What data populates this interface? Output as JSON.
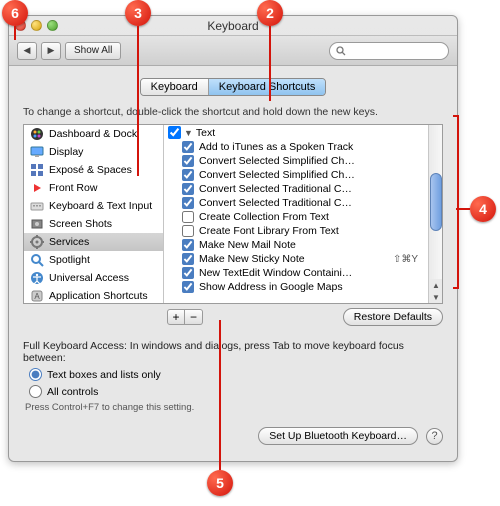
{
  "window": {
    "title": "Keyboard"
  },
  "toolbar": {
    "back_label": "◀",
    "fwd_label": "▶",
    "show_all": "Show All",
    "search_placeholder": ""
  },
  "tabs": [
    {
      "label": "Keyboard",
      "active": false
    },
    {
      "label": "Keyboard Shortcuts",
      "active": true
    }
  ],
  "hint": "To change a shortcut, double-click the shortcut and hold down the new keys.",
  "categories": [
    {
      "label": "Dashboard & Dock",
      "icon": "dashboard",
      "selected": false
    },
    {
      "label": "Display",
      "icon": "display",
      "selected": false
    },
    {
      "label": "Exposé & Spaces",
      "icon": "expose",
      "selected": false
    },
    {
      "label": "Front Row",
      "icon": "frontrow",
      "selected": false
    },
    {
      "label": "Keyboard & Text Input",
      "icon": "keyboard",
      "selected": false
    },
    {
      "label": "Screen Shots",
      "icon": "screenshots",
      "selected": false
    },
    {
      "label": "Services",
      "icon": "services",
      "selected": true
    },
    {
      "label": "Spotlight",
      "icon": "spotlight",
      "selected": false
    },
    {
      "label": "Universal Access",
      "icon": "universal",
      "selected": false
    },
    {
      "label": "Application Shortcuts",
      "icon": "appshort",
      "selected": false
    }
  ],
  "group_header": "Text",
  "services": [
    {
      "checked": true,
      "label": "Add to iTunes as a Spoken Track",
      "shortcut": ""
    },
    {
      "checked": true,
      "label": "Convert Selected Simplified Ch…",
      "shortcut": ""
    },
    {
      "checked": true,
      "label": "Convert Selected Simplified Ch…",
      "shortcut": ""
    },
    {
      "checked": true,
      "label": "Convert Selected Traditional C…",
      "shortcut": ""
    },
    {
      "checked": true,
      "label": "Convert Selected Traditional C…",
      "shortcut": ""
    },
    {
      "checked": false,
      "label": "Create Collection From Text",
      "shortcut": ""
    },
    {
      "checked": false,
      "label": "Create Font Library From Text",
      "shortcut": ""
    },
    {
      "checked": true,
      "label": "Make New Mail Note",
      "shortcut": ""
    },
    {
      "checked": true,
      "label": "Make New Sticky Note",
      "shortcut": "⇧⌘Y"
    },
    {
      "checked": true,
      "label": "New TextEdit Window Containi…",
      "shortcut": ""
    },
    {
      "checked": true,
      "label": "Show Address in Google Maps",
      "shortcut": ""
    }
  ],
  "buttons": {
    "add": "+",
    "remove": "−",
    "restore": "Restore Defaults",
    "bluetooth": "Set Up Bluetooth Keyboard…",
    "help": "?"
  },
  "fka": {
    "prompt": "Full Keyboard Access: In windows and dialogs, press Tab to move keyboard focus between:",
    "opt1": "Text boxes and lists only",
    "opt2": "All controls",
    "sub": "Press Control+F7 to change this setting."
  },
  "callouts": {
    "2": "2",
    "3": "3",
    "4": "4",
    "5": "5",
    "6": "6"
  }
}
